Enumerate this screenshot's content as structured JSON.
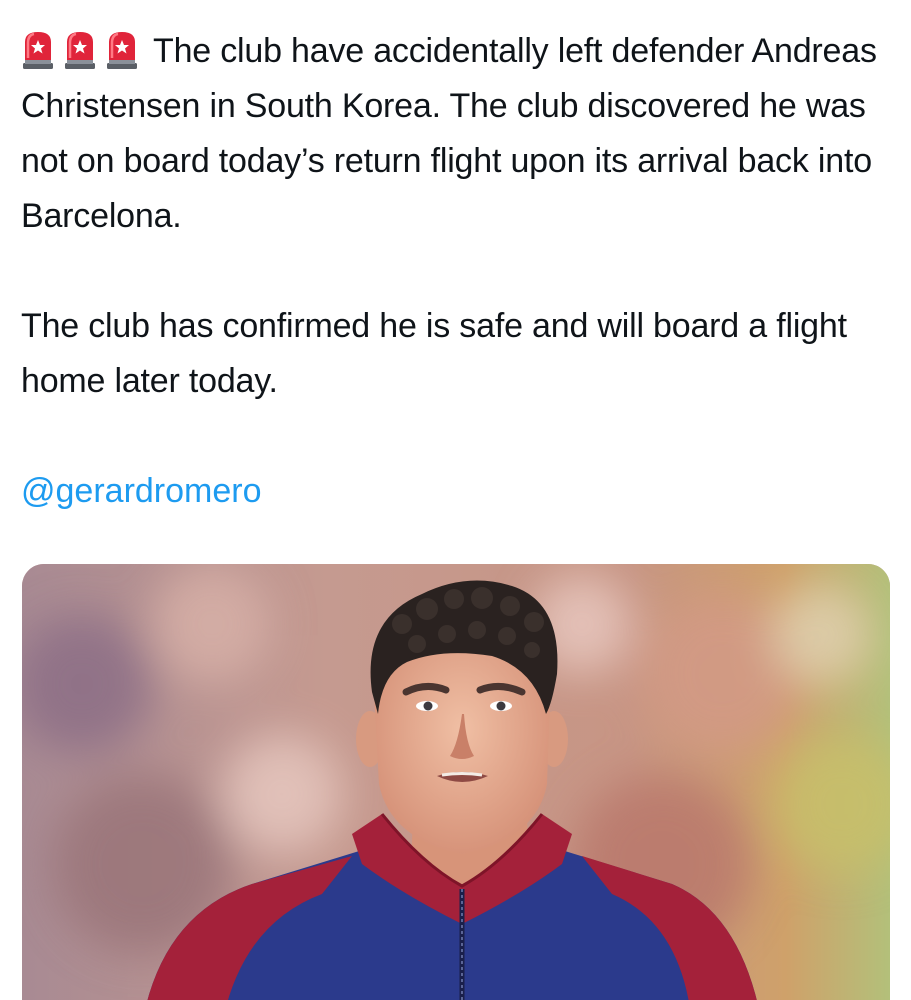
{
  "tweet": {
    "emojis": [
      "rotating-light-icon",
      "rotating-light-icon",
      "rotating-light-icon"
    ],
    "paragraph_1": "The club have accidentally left defender Andreas Christensen in South Korea. The club discovered he was not on board today’s return flight upon its arrival back into Barcelona.",
    "paragraph_2": "The club has confirmed he is safe and will board a flight home later today.",
    "mention": "@gerardromero",
    "link_color": "#1d9bf0"
  },
  "media": {
    "type": "photo",
    "subject": "footballer-portrait",
    "jacket_colors": {
      "body": "#2b3a8c",
      "trim": "#a4213a"
    }
  }
}
